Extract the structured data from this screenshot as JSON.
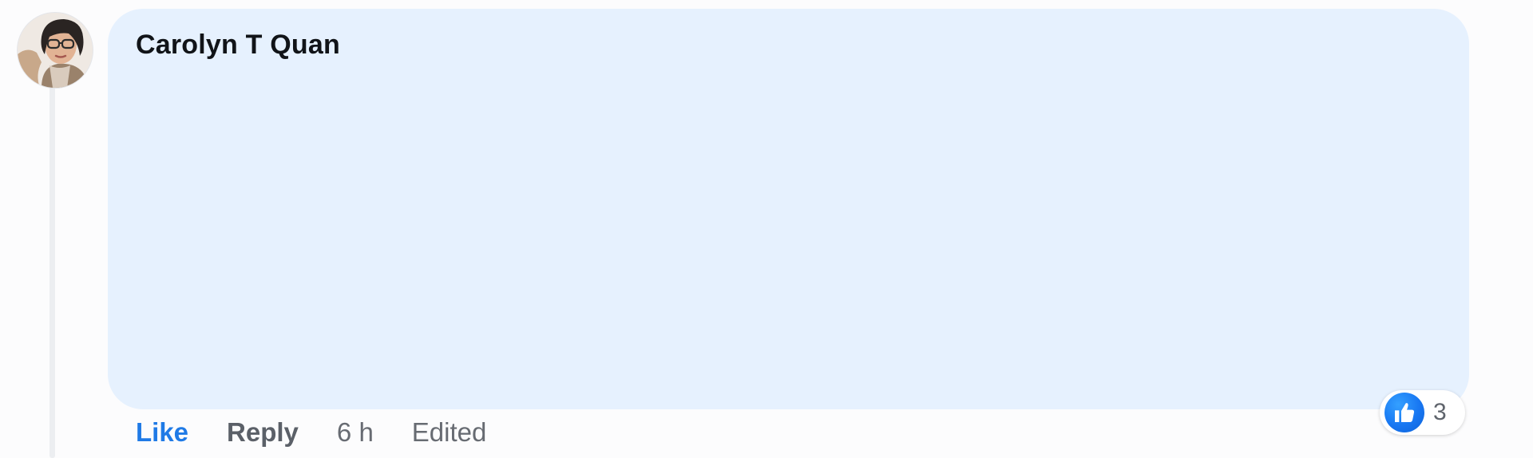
{
  "comment": {
    "author": "Carolyn T Quan",
    "avatar_icon": "profile-photo",
    "bubble_color": "#e6f1fe"
  },
  "actions": {
    "like_label": "Like",
    "reply_label": "Reply",
    "timestamp": "6 h",
    "edited_label": "Edited"
  },
  "reactions": {
    "icon": "thumbs-up-icon",
    "count": "3",
    "accent": "#1877f2"
  }
}
